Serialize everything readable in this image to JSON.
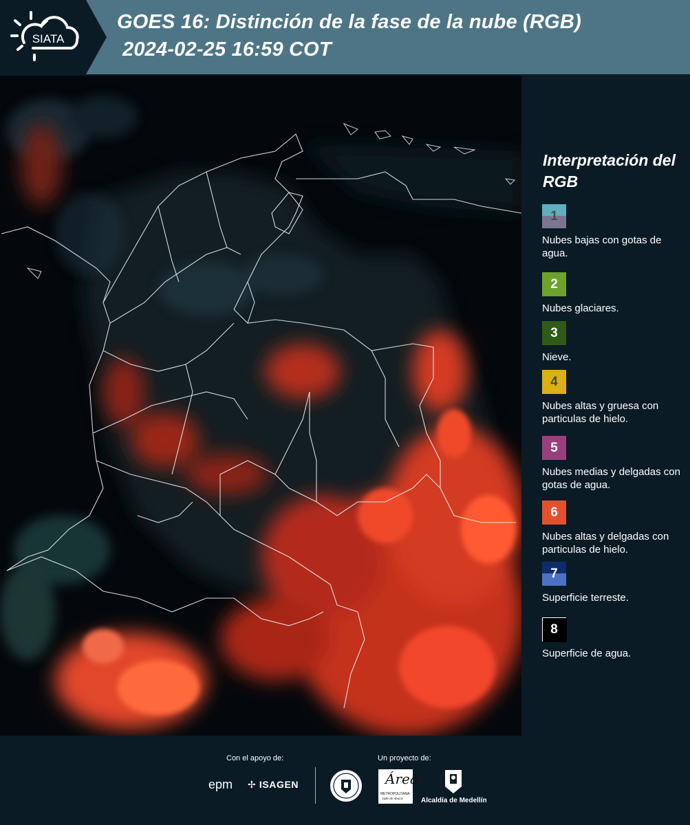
{
  "header": {
    "logo_text": "SIATA",
    "title_line1": "GOES 16: Distinción de la fase de la nube (RGB)",
    "title_line2": "2024-02-25 16:59 COT"
  },
  "legend": {
    "title": "Interpretación del RGB",
    "items": [
      {
        "number": "1",
        "label": "Nubes bajas con gotas de agua.",
        "color_top": "#5fb0bf",
        "color_bottom": "#7c7590",
        "text_color": "#4a4a4a"
      },
      {
        "number": "2",
        "label": "Nubes glaciares.",
        "color_top": "#6da22c",
        "color_bottom": "#6da22c",
        "text_color": "#ffffff"
      },
      {
        "number": "3",
        "label": "Nieve.",
        "color_top": "#2f5a18",
        "color_bottom": "#2f5a18",
        "text_color": "#ffffff"
      },
      {
        "number": "4",
        "label": "Nubes altas y gruesa con particulas de hielo.",
        "color_top": "#dcb014",
        "color_bottom": "#dcb014",
        "text_color": "#4a4a4a"
      },
      {
        "number": "5",
        "label": "Nubes medias y delgadas con gotas de agua.",
        "color_top": "#9a3f7e",
        "color_bottom": "#9a3f7e",
        "text_color": "#ffffff"
      },
      {
        "number": "6",
        "label": "Nubes altas y delgadas con particulas de hielo.",
        "color_top": "#e4502d",
        "color_bottom": "#e4502d",
        "text_color": "#ffffff"
      },
      {
        "number": "7",
        "label": "Superficie terreste.",
        "color_top": "#0d2c6c",
        "color_bottom": "#4d72c4",
        "text_color": "#ffffff"
      },
      {
        "number": "8",
        "label": "Superficie de agua.",
        "color_top": "#000000",
        "color_bottom": "#000000",
        "text_color": "#ffffff"
      }
    ]
  },
  "footer": {
    "support_label": "Con el apoyo de:",
    "project_label": "Un proyecto de:",
    "sponsor_epm": "epm",
    "sponsor_isagen": "ISAGEN",
    "area_logo_text": "Área",
    "area_sub1": "METROPOLITANA",
    "area_sub2": "Valle de Aburrá",
    "alcaldia": "Alcaldía de Medellín"
  },
  "colors": {
    "header_bg": "#4d7585",
    "page_bg": "#0b1b26",
    "cloud_red": "#ff4a2a"
  }
}
